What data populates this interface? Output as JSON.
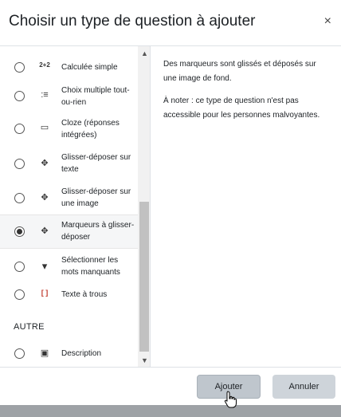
{
  "dialog": {
    "title": "Choisir un type de question à ajouter",
    "close_symbol": "×"
  },
  "questions": [
    {
      "label": "Calculée simple",
      "icon": "calculated-simple-icon",
      "glyph": "2+2",
      "checked": false
    },
    {
      "label": "Choix multiple tout-ou-rien",
      "icon": "multichoice-allornothing-icon",
      "glyph": ":≡",
      "checked": false
    },
    {
      "label": "Cloze (réponses intégrées)",
      "icon": "cloze-icon",
      "glyph": "▭",
      "checked": false
    },
    {
      "label": "Glisser-déposer sur texte",
      "icon": "drag-drop-text-icon",
      "glyph": "✥",
      "checked": false
    },
    {
      "label": "Glisser-déposer sur une image",
      "icon": "drag-drop-image-icon",
      "glyph": "✥",
      "checked": false
    },
    {
      "label": "Marqueurs à glisser-déposer",
      "icon": "drag-drop-markers-icon",
      "glyph": "✥",
      "checked": true
    },
    {
      "label": "Sélectionner les mots manquants",
      "icon": "select-missing-words-icon",
      "glyph": "▾",
      "checked": false
    },
    {
      "label": "Texte à trous",
      "icon": "gapfill-icon",
      "glyph": "[ ]",
      "checked": false
    }
  ],
  "section_other": {
    "heading": "AUTRE",
    "items": [
      {
        "label": "Description",
        "icon": "description-icon",
        "glyph": "▣",
        "checked": false
      }
    ]
  },
  "description": {
    "paragraph1": "Des marqueurs sont glissés et déposés sur une image de fond.",
    "paragraph2": "À noter : ce type de question n'est pas accessible pour les personnes malvoyantes."
  },
  "footer": {
    "add_label": "Ajouter",
    "cancel_label": "Annuler"
  },
  "colors": {
    "add_button": "#bfc6cd",
    "cancel_button": "#ced4da",
    "scrollbar_thumb": "#c1c1c1"
  }
}
